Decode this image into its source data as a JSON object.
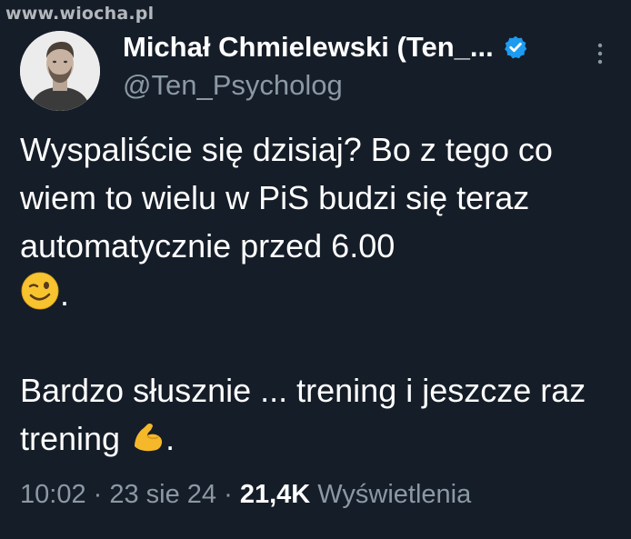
{
  "watermark": "www.wiocha.pl",
  "author": {
    "display_name": "Michał Chmielewski (Ten_...",
    "handle": "@Ten_Psycholog"
  },
  "tweet": {
    "paragraph1": "Wyspaliście się dzisiaj? Bo z tego co wiem to wielu w PiS budzi się teraz automatycznie przed 6.00",
    "paragraph1_end": ".",
    "paragraph2": "Bardzo słusznie ... trening i jeszcze raz trening",
    "paragraph2_end": "."
  },
  "meta": {
    "time": "10:02",
    "separator1": " · ",
    "date": "23 sie 24",
    "separator2": " · ",
    "views_count": "21,4K",
    "views_label": " Wyświetlenia"
  },
  "icons": {
    "verified": "verified-badge-icon",
    "more": "more-options-icon",
    "wink": "winking-face-emoji",
    "bicep": "flexed-biceps-emoji"
  },
  "colors": {
    "background": "#151d28",
    "text_primary": "#ffffff",
    "text_secondary": "#8b98a5",
    "verified": "#1d9bf0"
  }
}
